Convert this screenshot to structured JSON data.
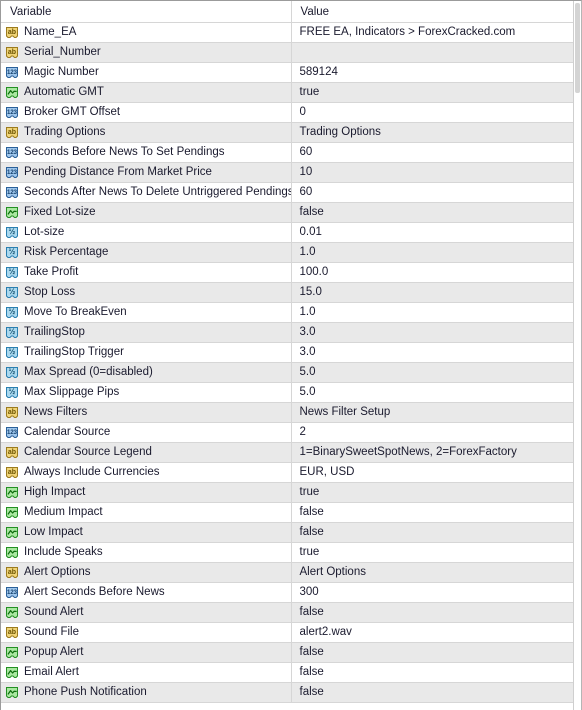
{
  "panel": {
    "name": "expert-advisor-inputs-grid",
    "columns": {
      "variable_header": "Variable",
      "value_header": "Value"
    }
  },
  "icons": {
    "string": "string-type-icon",
    "int": "integer-type-icon",
    "bool": "boolean-type-icon",
    "double": "double-type-icon"
  },
  "colors": {
    "row_odd": "#ffffff",
    "row_even": "#e9e9e9",
    "grid_line": "#d6d6d6",
    "text": "#1a1a2e",
    "icon_string_fill": "#f0d477",
    "icon_string_stroke": "#9c7b1e",
    "icon_int_fill": "#9ec6ec",
    "icon_int_stroke": "#2a6099",
    "icon_bool_fill": "#a9e8a0",
    "icon_bool_stroke": "#239023",
    "icon_double_fill": "#a9d8ef",
    "icon_double_stroke": "#2a7fb0"
  },
  "rows": [
    {
      "type": "string",
      "variable": "Name_EA",
      "value": "FREE EA, Indicators > ForexCracked.com"
    },
    {
      "type": "string",
      "variable": "Serial_Number",
      "value": ""
    },
    {
      "type": "int",
      "variable": "Magic Number",
      "value": "589124"
    },
    {
      "type": "bool",
      "variable": "Automatic GMT",
      "value": "true"
    },
    {
      "type": "int",
      "variable": "Broker GMT Offset",
      "value": "0"
    },
    {
      "type": "string",
      "variable": "Trading Options",
      "value": "Trading Options"
    },
    {
      "type": "int",
      "variable": "Seconds Before News To Set Pendings",
      "value": "60"
    },
    {
      "type": "int",
      "variable": "Pending Distance From Market Price",
      "value": "10"
    },
    {
      "type": "int",
      "variable": "Seconds After News To Delete Untriggered Pendings",
      "value": "60"
    },
    {
      "type": "bool",
      "variable": "Fixed Lot-size",
      "value": "false"
    },
    {
      "type": "double",
      "variable": "Lot-size",
      "value": "0.01"
    },
    {
      "type": "double",
      "variable": "Risk Percentage",
      "value": "1.0"
    },
    {
      "type": "double",
      "variable": "Take Profit",
      "value": "100.0"
    },
    {
      "type": "double",
      "variable": "Stop Loss",
      "value": "15.0"
    },
    {
      "type": "double",
      "variable": "Move To BreakEven",
      "value": "1.0"
    },
    {
      "type": "double",
      "variable": "TrailingStop",
      "value": "3.0"
    },
    {
      "type": "double",
      "variable": "TrailingStop Trigger",
      "value": "3.0"
    },
    {
      "type": "double",
      "variable": "Max Spread (0=disabled)",
      "value": "5.0"
    },
    {
      "type": "double",
      "variable": "Max Slippage Pips",
      "value": "5.0"
    },
    {
      "type": "string",
      "variable": "News Filters",
      "value": "News Filter Setup"
    },
    {
      "type": "int",
      "variable": "Calendar Source",
      "value": "2"
    },
    {
      "type": "string",
      "variable": "Calendar Source Legend",
      "value": "1=BinarySweetSpotNews, 2=ForexFactory"
    },
    {
      "type": "string",
      "variable": "Always Include Currencies",
      "value": "EUR, USD"
    },
    {
      "type": "bool",
      "variable": "High Impact",
      "value": "true"
    },
    {
      "type": "bool",
      "variable": "Medium Impact",
      "value": "false"
    },
    {
      "type": "bool",
      "variable": "Low Impact",
      "value": "false"
    },
    {
      "type": "bool",
      "variable": "Include Speaks",
      "value": "true"
    },
    {
      "type": "string",
      "variable": "Alert Options",
      "value": "Alert Options"
    },
    {
      "type": "int",
      "variable": "Alert Seconds Before News",
      "value": "300"
    },
    {
      "type": "bool",
      "variable": "Sound Alert",
      "value": "false"
    },
    {
      "type": "string",
      "variable": "Sound File",
      "value": "alert2.wav"
    },
    {
      "type": "bool",
      "variable": "Popup Alert",
      "value": "false"
    },
    {
      "type": "bool",
      "variable": "Email Alert",
      "value": "false"
    },
    {
      "type": "bool",
      "variable": "Phone Push Notification",
      "value": "false"
    }
  ]
}
